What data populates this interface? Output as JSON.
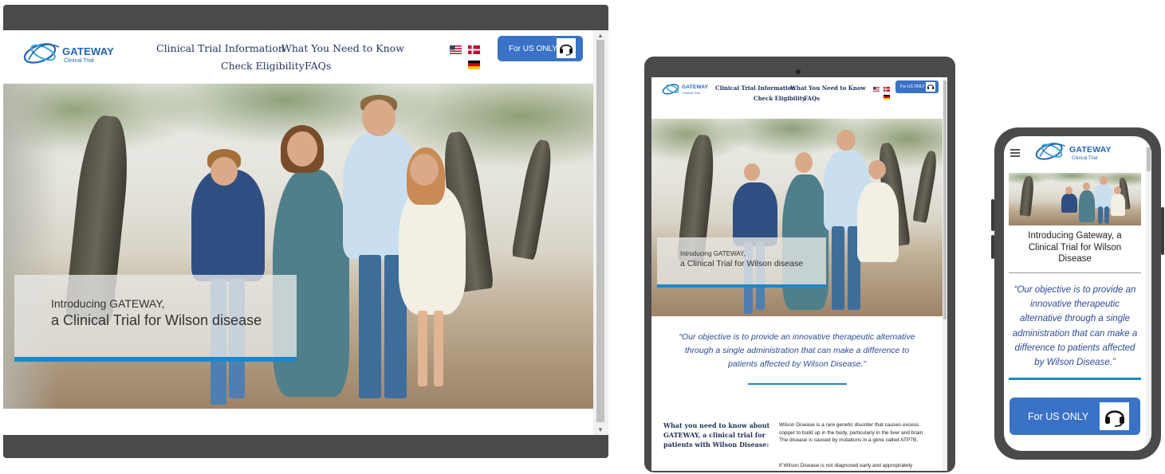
{
  "brand": {
    "name": "GATEWAY",
    "subtitle": "Clinical Trial"
  },
  "nav": {
    "items": [
      {
        "label": "Clinical Trial Information"
      },
      {
        "label": "What You Need to Know"
      },
      {
        "label": "Check Eligibility"
      },
      {
        "label": "FAQs"
      }
    ]
  },
  "languages": [
    {
      "code": "en-US",
      "icon": "us-flag-icon"
    },
    {
      "code": "da",
      "icon": "denmark-flag-icon"
    },
    {
      "code": "de",
      "icon": "germany-flag-icon"
    }
  ],
  "cta": {
    "label": "For US ONLY",
    "icon": "headset-icon"
  },
  "hero": {
    "line1": "Introducing GATEWAY,",
    "line2": "a Clinical Trial for Wilson disease"
  },
  "mobile_hero": {
    "title": "Introducing Gateway, a Clinical Trial for Wilson Disease"
  },
  "quote": {
    "text": "“Our objective is to provide an innovative therapeutic alternative through a single administration that can make a difference to patients affected by Wilson Disease.”"
  },
  "info": {
    "heading": "What you need to know about GATEWAY, a clinical trial for patients with Wilson Disease:",
    "paragraph1": "Wilson Disease is a rare genetic disorder that causes excess copper to build up in the body, particularly in the liver and brain. The disease is caused by mutations in a gene called ATP7B.",
    "paragraph2": "If Wilson Disease is not diagnosed early and appropriately"
  },
  "mobile_menu": {
    "icon": "hamburger-menu-icon"
  },
  "colors": {
    "device_frame": "#4a4a4a",
    "brand_blue": "#1f66b8",
    "cta_blue": "#3a72c8",
    "accent_bar": "#1d87c9",
    "nav_text": "#24365f",
    "quote_text": "#2a4a9a"
  }
}
